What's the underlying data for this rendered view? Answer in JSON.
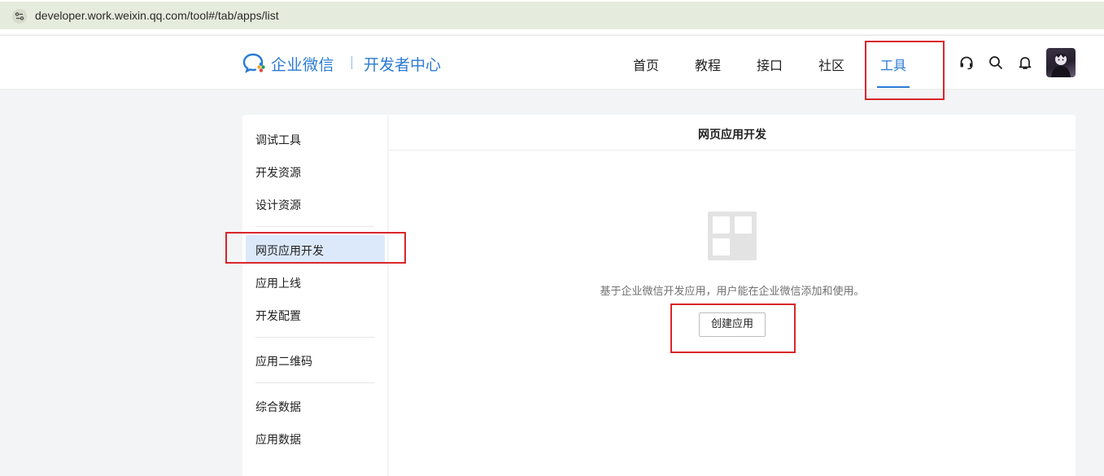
{
  "browser": {
    "url": "developer.work.weixin.qq.com/tool#/tab/apps/list"
  },
  "header": {
    "brand": "企业微信",
    "brand_sub": "开发者中心",
    "nav": [
      {
        "label": "首页"
      },
      {
        "label": "教程"
      },
      {
        "label": "接口"
      },
      {
        "label": "社区"
      },
      {
        "label": "工具",
        "active": true
      }
    ],
    "icons": [
      "headset-icon",
      "search-icon",
      "bell-icon",
      "avatar"
    ]
  },
  "sidebar": {
    "items": [
      {
        "label": "调试工具"
      },
      {
        "label": "开发资源"
      },
      {
        "label": "设计资源"
      },
      {
        "label": "网页应用开发",
        "active": true
      },
      {
        "label": "应用上线"
      },
      {
        "label": "开发配置"
      },
      {
        "label": "应用二维码"
      },
      {
        "label": "综合数据"
      },
      {
        "label": "应用数据"
      }
    ]
  },
  "main": {
    "title": "网页应用开发",
    "empty_description": "基于企业微信开发应用，用户能在企业微信添加和使用。",
    "create_button": "创建应用"
  },
  "colors": {
    "accent": "#2a7bd2",
    "highlight": "#d9262c",
    "active_bg": "#dce9fb"
  }
}
